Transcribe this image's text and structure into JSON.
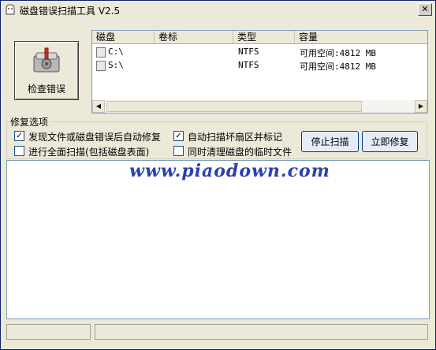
{
  "window": {
    "title": "磁盘错误扫描工具 V2.5",
    "close_glyph": "✕"
  },
  "scan_button": {
    "label": "检查错误"
  },
  "drive_list": {
    "columns": [
      "磁盘",
      "卷标",
      "类型",
      "容量"
    ],
    "rows": [
      {
        "drive": "C:\\",
        "label": "",
        "type": "NTFS",
        "capacity": "可用空间:4812 MB"
      },
      {
        "drive": "S:\\",
        "label": "",
        "type": "NTFS",
        "capacity": "可用空间:4812 MB"
      }
    ]
  },
  "options": {
    "title": "修复选项",
    "auto_fix": {
      "label": "发现文件或磁盘错误后自动修复",
      "checked": true,
      "mark": "✓"
    },
    "full_scan": {
      "label": "进行全面扫描(包括磁盘表面)",
      "checked": false,
      "mark": ""
    },
    "bad_sectors": {
      "label": "自动扫描坏扇区并标记",
      "checked": true,
      "mark": "✓"
    },
    "clean_temp": {
      "label": "同时清理磁盘的临时文件",
      "checked": false,
      "mark": ""
    }
  },
  "buttons": {
    "stop": "停止扫描",
    "fix_now": "立即修复"
  },
  "watermark": "www.piaodown.com",
  "scroll": {
    "left_arrow": "◀",
    "right_arrow": "▶"
  }
}
